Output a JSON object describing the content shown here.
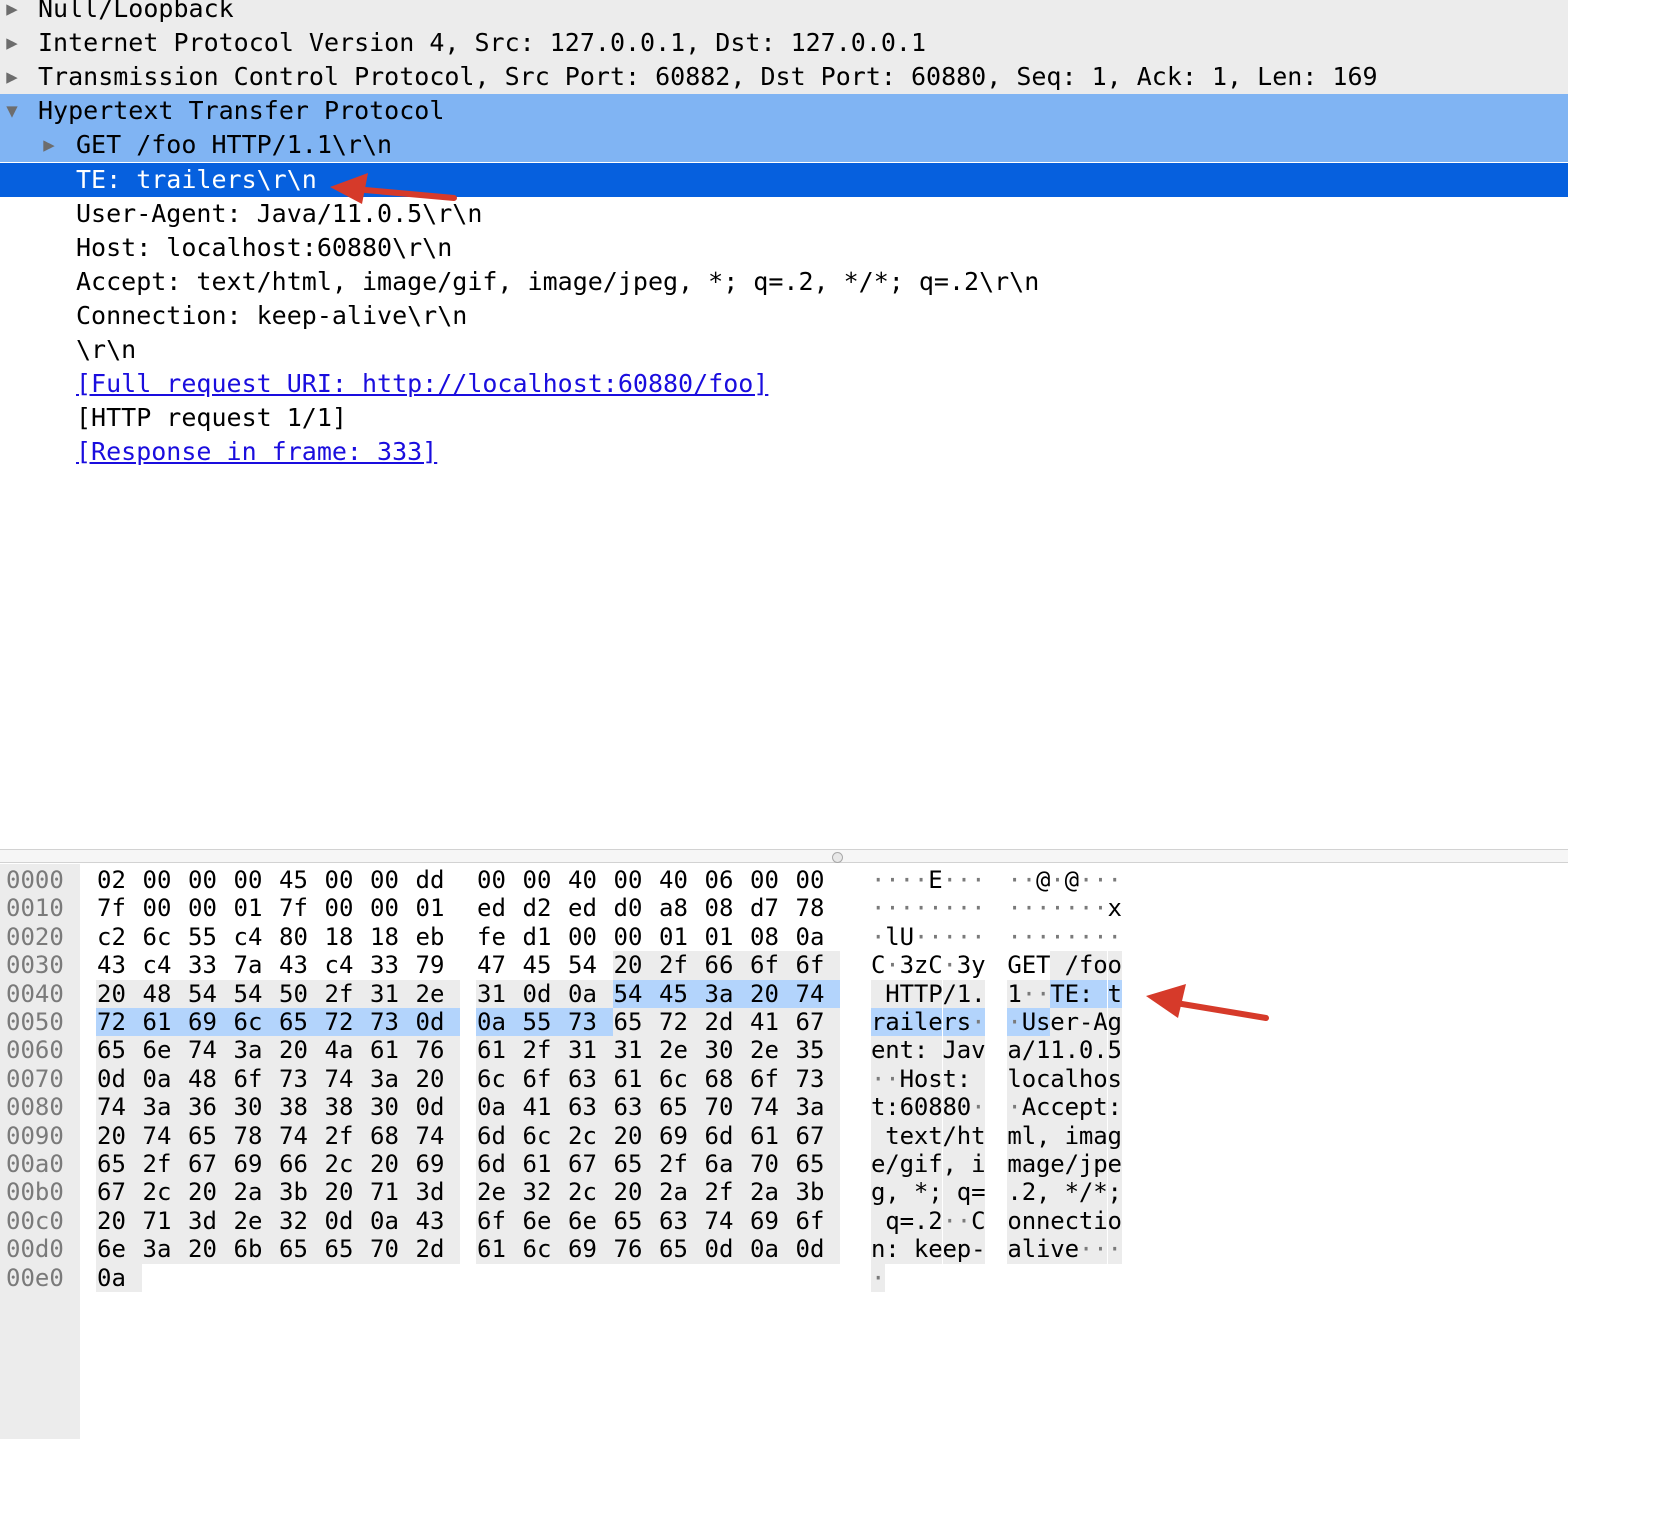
{
  "detail_tree": {
    "rows": [
      {
        "label": "Null/Loopback",
        "level": 0,
        "expander": "collapsed",
        "style": "gray"
      },
      {
        "label": "Internet Protocol Version 4, Src: 127.0.0.1, Dst: 127.0.0.1",
        "level": 0,
        "expander": "collapsed",
        "style": "gray"
      },
      {
        "label": "Transmission Control Protocol, Src Port: 60882, Dst Port: 60880, Seq: 1, Ack: 1, Len: 169",
        "level": 0,
        "expander": "collapsed",
        "style": "gray"
      },
      {
        "label": "Hypertext Transfer Protocol",
        "level": 0,
        "expander": "expanded",
        "style": "highlight"
      },
      {
        "label": "GET /foo HTTP/1.1\\r\\n",
        "level": 1,
        "expander": "collapsed",
        "style": "highlight"
      },
      {
        "label": "TE: trailers\\r\\n",
        "level": 1,
        "expander": "none",
        "style": "selected"
      },
      {
        "label": "User-Agent: Java/11.0.5\\r\\n",
        "level": 1,
        "expander": "none",
        "style": "plain"
      },
      {
        "label": "Host: localhost:60880\\r\\n",
        "level": 1,
        "expander": "none",
        "style": "plain"
      },
      {
        "label": "Accept: text/html, image/gif, image/jpeg, *; q=.2, */*; q=.2\\r\\n",
        "level": 1,
        "expander": "none",
        "style": "plain"
      },
      {
        "label": "Connection: keep-alive\\r\\n",
        "level": 1,
        "expander": "none",
        "style": "plain"
      },
      {
        "label": "\\r\\n",
        "level": 1,
        "expander": "none",
        "style": "plain"
      },
      {
        "label": "[Full request URI: http://localhost:60880/foo]",
        "level": 1,
        "expander": "none",
        "style": "link"
      },
      {
        "label": "[HTTP request 1/1]",
        "level": 1,
        "expander": "none",
        "style": "plain"
      },
      {
        "label": "[Response in frame: 333]",
        "level": 1,
        "expander": "none",
        "style": "link"
      }
    ]
  },
  "bytes_pane": {
    "hex": "02000000450000dd000040004006000 07f0000017f000001edd2edd0a808d778c26c55c4801818ebfed1000001010 80a43c4337a43c4337947455420 2f666f6f20485454502f312e310d0a54453a20747261696c6572730d0a557365722d4167656e743a204a6176612f31312e302e350d0a486f73743a206c6f63616c686f73743a36303838300d0a4163636570743a20746578742f68746d6c2c20696d6167652f6769662c20696d6167652f6a7065672c202a3b20713d2e322c202a2f2a3b20713d2e320d0a436f6e6e656374696f6e3a206b6565702d616c6976650d0a0d0a",
    "offsets": [
      "0000",
      "0010",
      "0020",
      "0030",
      "0040",
      "0050",
      "0060",
      "0070",
      "0080",
      "0090",
      "00a0",
      "00b0",
      "00c0",
      "00d0",
      "00e0"
    ],
    "bytes": [
      [
        "02",
        "00",
        "00",
        "00",
        "45",
        "00",
        "00",
        "dd",
        "00",
        "00",
        "40",
        "00",
        "40",
        "06",
        "00",
        "00"
      ],
      [
        "7f",
        "00",
        "00",
        "01",
        "7f",
        "00",
        "00",
        "01",
        "ed",
        "d2",
        "ed",
        "d0",
        "a8",
        "08",
        "d7",
        "78"
      ],
      [
        "c2",
        "6c",
        "55",
        "c4",
        "80",
        "18",
        "18",
        "eb",
        "fe",
        "d1",
        "00",
        "00",
        "01",
        "01",
        "08",
        "0a"
      ],
      [
        "43",
        "c4",
        "33",
        "7a",
        "43",
        "c4",
        "33",
        "79",
        "47",
        "45",
        "54",
        "20",
        "2f",
        "66",
        "6f",
        "6f"
      ],
      [
        "20",
        "48",
        "54",
        "54",
        "50",
        "2f",
        "31",
        "2e",
        "31",
        "0d",
        "0a",
        "54",
        "45",
        "3a",
        "20",
        "74"
      ],
      [
        "72",
        "61",
        "69",
        "6c",
        "65",
        "72",
        "73",
        "0d",
        "0a",
        "55",
        "73",
        "65",
        "72",
        "2d",
        "41",
        "67"
      ],
      [
        "65",
        "6e",
        "74",
        "3a",
        "20",
        "4a",
        "61",
        "76",
        "61",
        "2f",
        "31",
        "31",
        "2e",
        "30",
        "2e",
        "35"
      ],
      [
        "0d",
        "0a",
        "48",
        "6f",
        "73",
        "74",
        "3a",
        "20",
        "6c",
        "6f",
        "63",
        "61",
        "6c",
        "68",
        "6f",
        "73"
      ],
      [
        "74",
        "3a",
        "36",
        "30",
        "38",
        "38",
        "30",
        "0d",
        "0a",
        "41",
        "63",
        "63",
        "65",
        "70",
        "74",
        "3a"
      ],
      [
        "20",
        "74",
        "65",
        "78",
        "74",
        "2f",
        "68",
        "74",
        "6d",
        "6c",
        "2c",
        "20",
        "69",
        "6d",
        "61",
        "67"
      ],
      [
        "65",
        "2f",
        "67",
        "69",
        "66",
        "2c",
        "20",
        "69",
        "6d",
        "61",
        "67",
        "65",
        "2f",
        "6a",
        "70",
        "65"
      ],
      [
        "67",
        "2c",
        "20",
        "2a",
        "3b",
        "20",
        "71",
        "3d",
        "2e",
        "32",
        "2c",
        "20",
        "2a",
        "2f",
        "2a",
        "3b"
      ],
      [
        "20",
        "71",
        "3d",
        "2e",
        "32",
        "0d",
        "0a",
        "43",
        "6f",
        "6e",
        "6e",
        "65",
        "63",
        "74",
        "69",
        "6f"
      ],
      [
        "6e",
        "3a",
        "20",
        "6b",
        "65",
        "65",
        "70",
        "2d",
        "61",
        "6c",
        "69",
        "76",
        "65",
        "0d",
        "0a",
        "0d"
      ],
      [
        "0a"
      ]
    ],
    "http_start": 59,
    "selected_range": [
      75,
      90
    ],
    "colors": {
      "http_bg": "#ececec",
      "selected_bg": "#b3d4fc",
      "tree_highlight": "#80b4f3",
      "tree_selected": "#0660de",
      "link": "#1a0dde",
      "arrow": "#d63a2a"
    }
  }
}
